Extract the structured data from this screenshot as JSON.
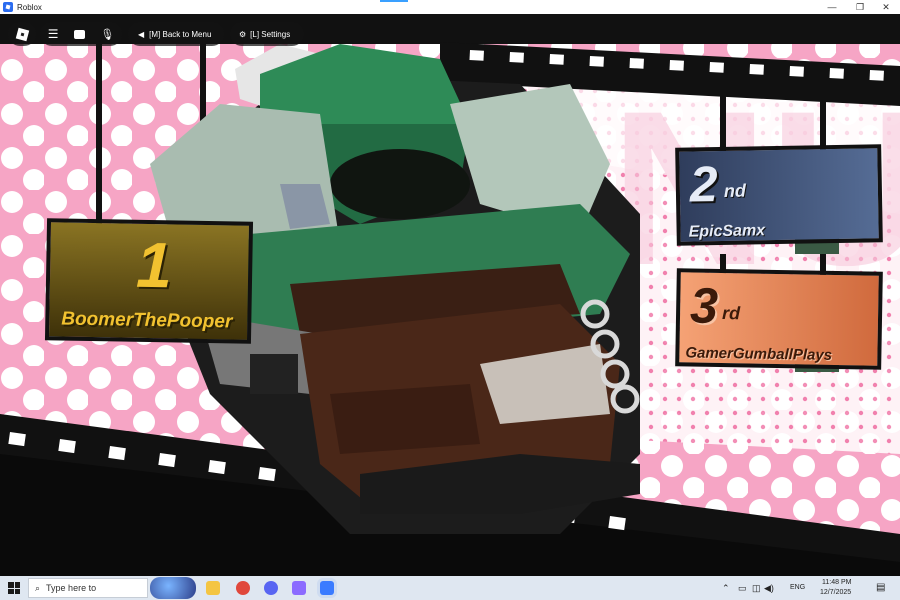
{
  "window": {
    "title": "Roblox",
    "controls": {
      "minimize": "—",
      "maximize": "❐",
      "close": "✕"
    }
  },
  "game_ui": {
    "back_to_menu": "[M] Back to Menu",
    "settings": "[L] Settings"
  },
  "podium": {
    "first": {
      "rank": "1",
      "name": "BoomerThePooper"
    },
    "second": {
      "rank": "2",
      "suffix": "nd",
      "name": "EpicSamx"
    },
    "third": {
      "rank": "3",
      "suffix": "rd",
      "name": "GamerGumballPlays"
    }
  },
  "background_text": "NU",
  "taskbar": {
    "search_placeholder": "Type here to",
    "language": "ENG",
    "time": "11:48 PM",
    "date": "12/7/2025"
  },
  "colors": {
    "pink": "#f4a3c4",
    "hot_pink": "#ef5e9a",
    "gold": "#f2c230",
    "first_card": "#6b5a1a",
    "second_card": "#3b4b6e",
    "third_card": "#e8895a",
    "hood_green": "#2e8b57"
  }
}
